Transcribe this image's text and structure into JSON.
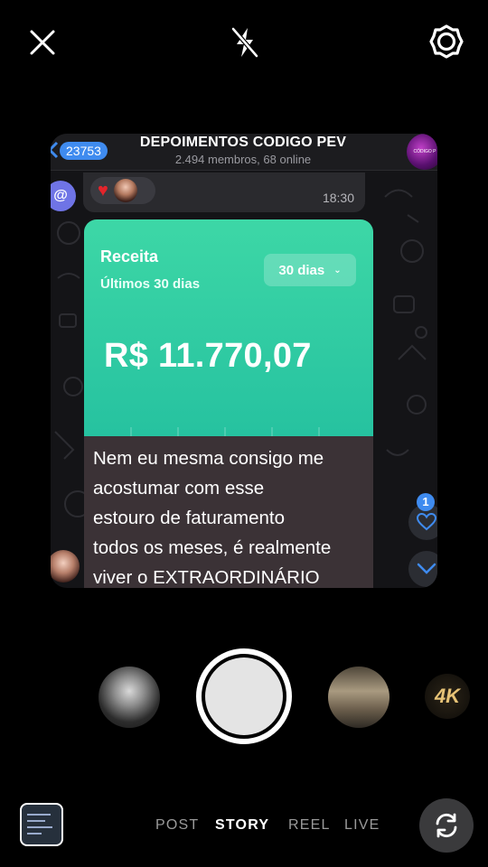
{
  "camera": {
    "close_icon": "close-icon",
    "flash_icon": "flash-off-icon",
    "settings_icon": "gear-icon"
  },
  "preview": {
    "header": {
      "unread_count": "23753",
      "title": "DEPOIMENTOS CODIGO PEV",
      "subtitle": "2.494 membros, 68 online",
      "avatar_text": "CÓDIGO P"
    },
    "top_message": {
      "time": "18:30"
    },
    "mention_label": "@",
    "receipt": {
      "title": "Receita",
      "period": "Últimos 30 dias",
      "select_value": "30 dias",
      "amount": "R$ 11.770,07"
    },
    "caption_lines": [
      "Nem eu mesma consigo me",
      "acostumar com esse",
      "estouro de faturamento",
      "todos os meses, é realmente",
      "viver o EXTRAORDINÁRIO"
    ],
    "like_count": "1"
  },
  "bottom": {
    "effect_4k": "4K",
    "modes": [
      "POST",
      "STORY",
      "REEL",
      "LIVE"
    ],
    "active_mode": "STORY"
  },
  "colors": {
    "accent_green": "#3dd7a6",
    "badge_blue": "#3f8bef"
  }
}
